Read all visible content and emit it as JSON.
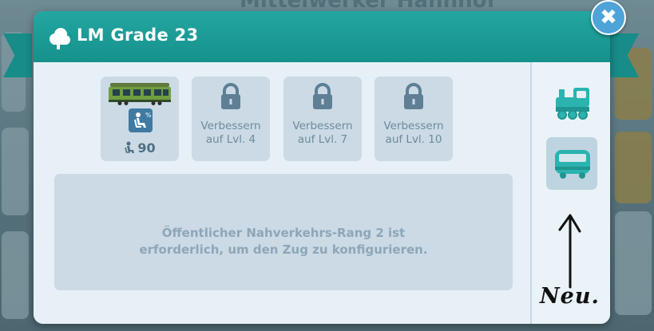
{
  "background": {
    "title_text": "Mittelwerker Hahnhof"
  },
  "dialog": {
    "title": "LM Grade 23",
    "title_icon": "cloud-icon",
    "header_color": "#1b9b96"
  },
  "slots": [
    {
      "type": "unlocked",
      "icon": "train-car-icon",
      "badge_icon": "seat-icon",
      "capacity_icon": "passenger-icon",
      "capacity": "90"
    },
    {
      "type": "locked",
      "icon": "lock-icon",
      "line1": "Verbessern",
      "line2": "auf Lvl. 4"
    },
    {
      "type": "locked",
      "icon": "lock-icon",
      "line1": "Verbessern",
      "line2": "auf Lvl. 7"
    },
    {
      "type": "locked",
      "icon": "lock-icon",
      "line1": "Verbessern",
      "line2": "auf Lvl. 10"
    }
  ],
  "info": {
    "line1": "Öffentlicher Nahverkehrs-Rang 2 ist",
    "line2": "erforderlich, um den Zug zu konfigurieren."
  },
  "sidebar": {
    "tabs": [
      {
        "icon": "locomotive-icon",
        "active": false
      },
      {
        "icon": "wagon-icon",
        "active": true
      }
    ]
  },
  "close_button": {
    "icon": "close-icon",
    "label": "✖"
  },
  "annotation": {
    "text": "Neu.",
    "icon": "arrow-up-icon"
  },
  "colors": {
    "accent": "#1b9b96",
    "panel": "#cbdae5",
    "muted_text": "#6f8a9c"
  }
}
